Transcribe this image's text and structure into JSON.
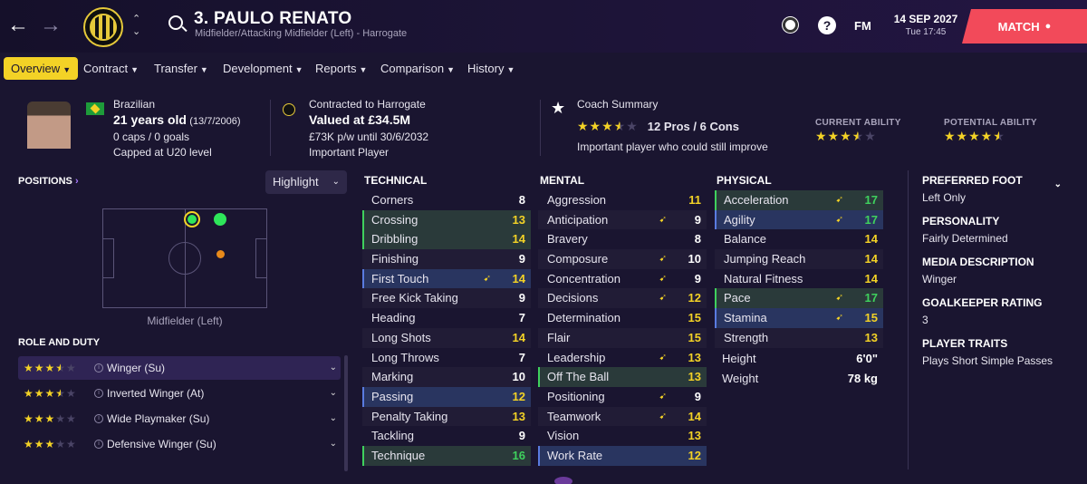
{
  "header": {
    "back": "←",
    "forward": "→",
    "up": "⌃",
    "down": "⌄",
    "name": "3. PAULO RENATO",
    "subtitle": "Midfielder/Attacking Midfielder (Left) - Harrogate",
    "fm": "FM",
    "date": "14 SEP 2027",
    "time": "Tue 17:45",
    "match_label": "MATCH",
    "help": "?"
  },
  "tabs": [
    {
      "label": "Overview"
    },
    {
      "label": "Contract"
    },
    {
      "label": "Transfer"
    },
    {
      "label": "Development"
    },
    {
      "label": "Reports"
    },
    {
      "label": "Comparison"
    },
    {
      "label": "History"
    }
  ],
  "info": {
    "nationality": "Brazilian",
    "age": "21 years old",
    "dob": "(13/7/2006)",
    "caps": "0 caps / 0 goals",
    "capped": "Capped at U20 level",
    "contract_label": "Contracted to Harrogate",
    "value": "Valued at £34.5M",
    "wage": "£73K p/w until 30/6/2032",
    "status": "Important Player",
    "coach_title": "Coach Summary",
    "pros_cons": "12 Pros / 6 Cons",
    "coach_desc": "Important player who could still improve",
    "current_ability_label": "CURRENT ABILITY",
    "potential_ability_label": "POTENTIAL ABILITY",
    "coach_stars": 3.5,
    "current_stars": 3.5,
    "potential_stars": 4.5
  },
  "positions": {
    "title": "POSITIONS",
    "highlight": "Highlight",
    "label": "Midfielder (Left)",
    "colors": {
      "natural": "#2ee65a",
      "accomplished": "#e88a1a"
    }
  },
  "roles": {
    "title": "ROLE AND DUTY",
    "items": [
      {
        "name": "Winger (Su)",
        "stars": 3.5
      },
      {
        "name": "Inverted Winger (At)",
        "stars": 3.5
      },
      {
        "name": "Wide Playmaker (Su)",
        "stars": 3
      },
      {
        "name": "Defensive Winger (Su)",
        "stars": 3
      }
    ]
  },
  "technical": {
    "title": "TECHNICAL",
    "rows": [
      {
        "name": "Corners",
        "value": "8"
      },
      {
        "name": "Crossing",
        "value": "13",
        "hl": "green"
      },
      {
        "name": "Dribbling",
        "value": "14",
        "hl": "green"
      },
      {
        "name": "Finishing",
        "value": "9"
      },
      {
        "name": "First Touch",
        "value": "14",
        "hl": "blue",
        "arrow": true
      },
      {
        "name": "Free Kick Taking",
        "value": "9"
      },
      {
        "name": "Heading",
        "value": "7"
      },
      {
        "name": "Long Shots",
        "value": "14"
      },
      {
        "name": "Long Throws",
        "value": "7"
      },
      {
        "name": "Marking",
        "value": "10"
      },
      {
        "name": "Passing",
        "value": "12",
        "hl": "blue"
      },
      {
        "name": "Penalty Taking",
        "value": "13"
      },
      {
        "name": "Tackling",
        "value": "9"
      },
      {
        "name": "Technique",
        "value": "16",
        "hl": "green"
      }
    ]
  },
  "mental": {
    "title": "MENTAL",
    "rows": [
      {
        "name": "Aggression",
        "value": "11"
      },
      {
        "name": "Anticipation",
        "value": "9",
        "arrow": true
      },
      {
        "name": "Bravery",
        "value": "8"
      },
      {
        "name": "Composure",
        "value": "10",
        "arrow": true
      },
      {
        "name": "Concentration",
        "value": "9",
        "arrow": true
      },
      {
        "name": "Decisions",
        "value": "12",
        "arrow": true
      },
      {
        "name": "Determination",
        "value": "15"
      },
      {
        "name": "Flair",
        "value": "15"
      },
      {
        "name": "Leadership",
        "value": "13",
        "arrow": true
      },
      {
        "name": "Off The Ball",
        "value": "13",
        "hl": "green"
      },
      {
        "name": "Positioning",
        "value": "9",
        "arrow": true
      },
      {
        "name": "Teamwork",
        "value": "14",
        "arrow": true
      },
      {
        "name": "Vision",
        "value": "13"
      },
      {
        "name": "Work Rate",
        "value": "12",
        "hl": "blue"
      }
    ]
  },
  "physical": {
    "title": "PHYSICAL",
    "rows": [
      {
        "name": "Acceleration",
        "value": "17",
        "hl": "green",
        "arrow": true
      },
      {
        "name": "Agility",
        "value": "17",
        "hl": "blue",
        "arrow": true
      },
      {
        "name": "Balance",
        "value": "14"
      },
      {
        "name": "Jumping Reach",
        "value": "14"
      },
      {
        "name": "Natural Fitness",
        "value": "14"
      },
      {
        "name": "Pace",
        "value": "17",
        "hl": "green",
        "arrow": true
      },
      {
        "name": "Stamina",
        "value": "15",
        "hl": "blue",
        "arrow": true
      },
      {
        "name": "Strength",
        "value": "13"
      }
    ],
    "height_label": "Height",
    "height": "6'0\"",
    "weight_label": "Weight",
    "weight": "78 kg"
  },
  "side": {
    "foot_title": "PREFERRED FOOT",
    "foot": "Left Only",
    "personality_title": "PERSONALITY",
    "personality": "Fairly Determined",
    "media_title": "MEDIA DESCRIPTION",
    "media": "Winger",
    "gk_title": "GOALKEEPER RATING",
    "gk": "3",
    "traits_title": "PLAYER TRAITS",
    "traits": "Plays Short Simple Passes"
  }
}
